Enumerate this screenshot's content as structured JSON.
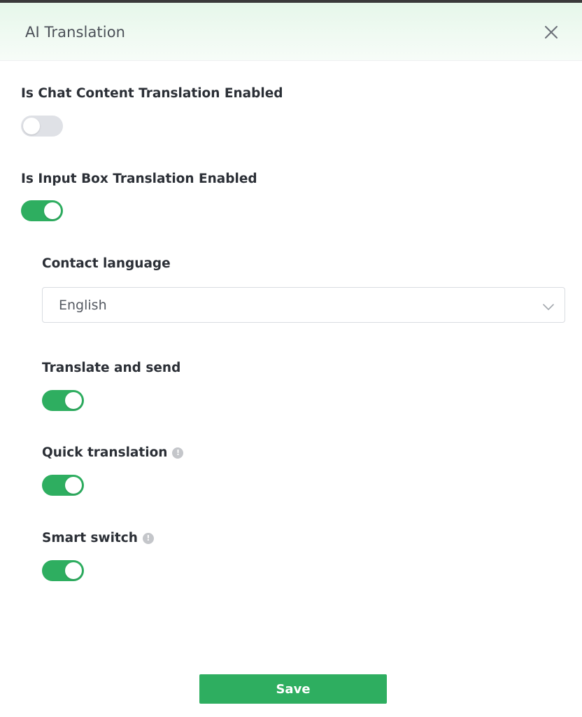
{
  "dialog": {
    "title": "AI Translation"
  },
  "settings": {
    "chat_content": {
      "label": "Is Chat Content Translation Enabled",
      "enabled": false
    },
    "input_box": {
      "label": "Is Input Box Translation Enabled",
      "enabled": true
    },
    "contact_language": {
      "label": "Contact language",
      "value": "English"
    },
    "translate_and_send": {
      "label": "Translate and send",
      "enabled": true
    },
    "quick_translation": {
      "label": "Quick translation",
      "info_icon": "!",
      "enabled": true
    },
    "smart_switch": {
      "label": "Smart switch",
      "info_icon": "!",
      "enabled": true
    }
  },
  "footer": {
    "save_label": "Save"
  },
  "colors": {
    "accent": "#2eae60",
    "switch_off": "#dfe1e6",
    "header_gradient_top": "#e6f7ea"
  },
  "icons": {
    "close": "close-icon",
    "dropdown": "chevron-down-icon",
    "info": "info-icon"
  }
}
